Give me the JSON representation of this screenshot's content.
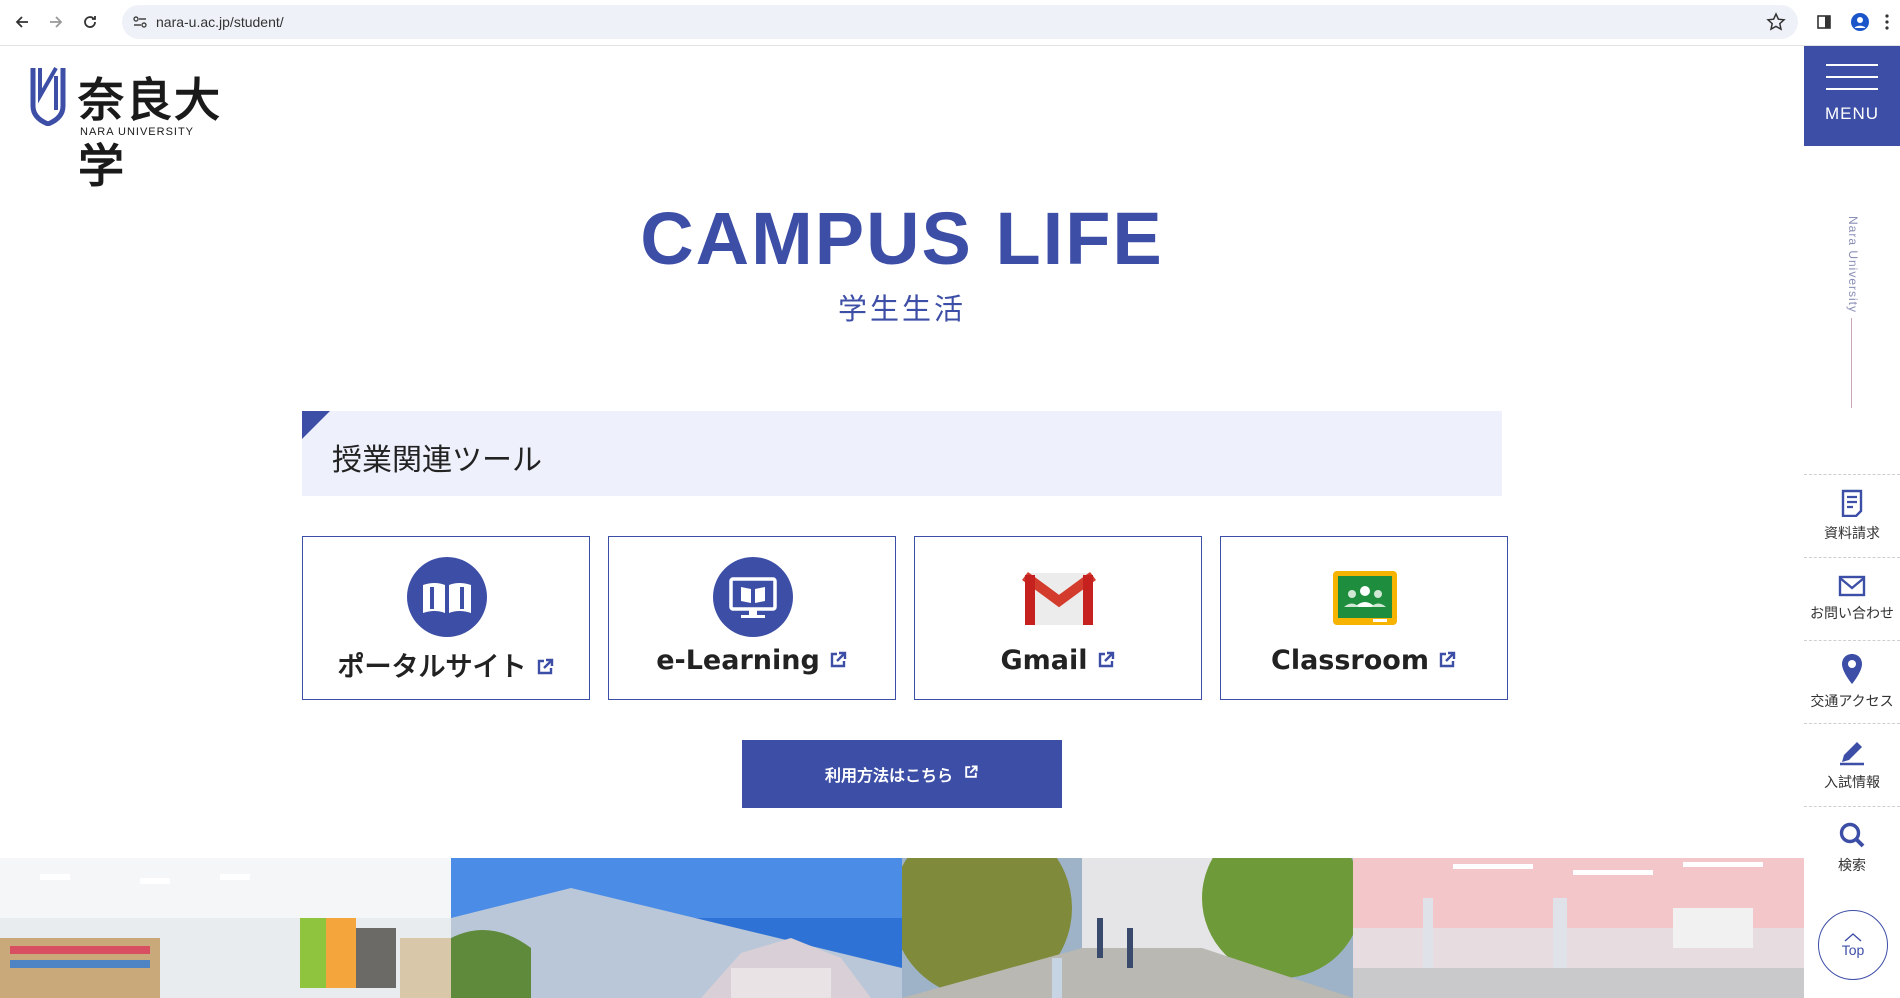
{
  "browser": {
    "url": "nara-u.ac.jp/student/"
  },
  "header": {
    "logo_jp": "奈良大学",
    "logo_en": "NARA UNIVERSITY",
    "menu_label": "MENU"
  },
  "hero": {
    "title": "CAMPUS LIFE",
    "subtitle": "学生生活"
  },
  "section": {
    "title": "授業関連ツール"
  },
  "tools": [
    {
      "label": "ポータルサイト",
      "icon": "book-icon"
    },
    {
      "label": "e-Learning",
      "icon": "monitor-book-icon"
    },
    {
      "label": "Gmail",
      "icon": "gmail-icon"
    },
    {
      "label": "Classroom",
      "icon": "classroom-icon"
    }
  ],
  "how_to": {
    "label": "利用方法はこちら"
  },
  "sidebar": {
    "vertical_text": "Nara University",
    "items": [
      {
        "label": "資料請求",
        "icon": "document-icon"
      },
      {
        "label": "お問い合わせ",
        "icon": "mail-icon"
      },
      {
        "label": "交通アクセス",
        "icon": "map-pin-icon"
      },
      {
        "label": "入試情報",
        "icon": "pencil-icon"
      },
      {
        "label": "検索",
        "icon": "search-icon"
      }
    ],
    "top_label": "Top"
  },
  "colors": {
    "brand": "#3d4ea6",
    "section_bg": "#eef1fc"
  }
}
